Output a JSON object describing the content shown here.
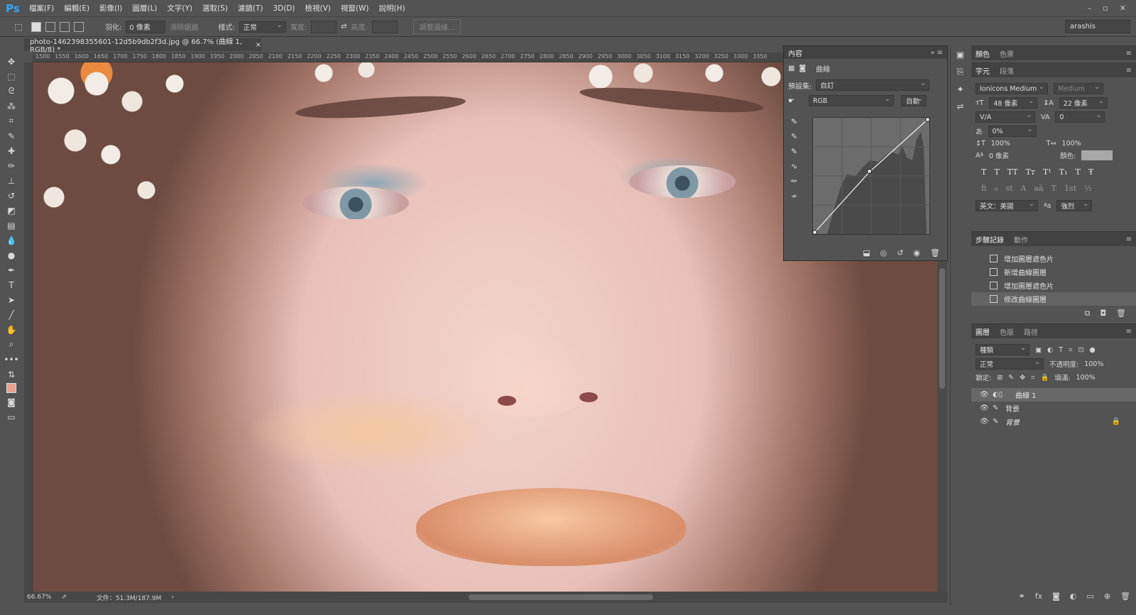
{
  "app": {
    "logo": "Ps"
  },
  "menu": [
    "檔案(F)",
    "編輯(E)",
    "影像(I)",
    "圖層(L)",
    "文字(Y)",
    "選取(S)",
    "濾鏡(T)",
    "3D(D)",
    "檢視(V)",
    "視窗(W)",
    "說明(H)"
  ],
  "window_controls": [
    "–",
    "▫",
    "✕"
  ],
  "options": {
    "feather_label": "羽化:",
    "feather_value": "0 像素",
    "antialias_label": "消除鋸齒",
    "style_label": "樣式:",
    "style_value": "正常",
    "width_label": "寬度:",
    "height_label": "高度:",
    "refine_button": "調整邊緣...",
    "workspace": "arashis"
  },
  "document": {
    "tab_title": "photo-1462398355601-12d5b9db2f3d.jpg @ 66.7% (曲線 1, RGB/8) *",
    "close": "×",
    "ruler_ticks": [
      "1500",
      "1550",
      "1600",
      "1650",
      "1700",
      "1750",
      "1800",
      "1850",
      "1900",
      "1950",
      "2000",
      "2050",
      "2100",
      "2150",
      "2200",
      "2250",
      "2300",
      "2350",
      "2400",
      "2450",
      "2500",
      "2550",
      "2600",
      "2650",
      "2700",
      "2750",
      "2800",
      "2850",
      "2900",
      "2950",
      "3000",
      "3050",
      "3100",
      "3150",
      "3200",
      "3250",
      "3300",
      "3350"
    ]
  },
  "status": {
    "zoom": "66.67%",
    "doc_size": "文件：51.3M/187.9M"
  },
  "properties": {
    "tab": "內容",
    "type_label": "曲線",
    "preset_label": "預設集:",
    "preset_value": "自訂",
    "channel": "RGB",
    "auto_button": "自動"
  },
  "character": {
    "tabs": [
      "字元",
      "段落"
    ],
    "font_family": "Ionicons Medium",
    "font_style": "Medium",
    "font_size": "48 像素",
    "leading": "22 像素",
    "kerning": "V/A",
    "tracking": "0",
    "scale_pct": "0%",
    "vscale": "100%",
    "hscale": "100%",
    "baseline": "0 像素",
    "color_label": "顏色:",
    "language": "英文：美國",
    "aa_label": "ªa",
    "antialias": "強烈",
    "style_glyphs": [
      "T",
      "T",
      "TT",
      "Tт",
      "T¹",
      "T₁",
      "T",
      "Ŧ"
    ],
    "ot_glyphs": [
      "fi",
      "ℴ",
      "st",
      "A",
      "aā",
      "T",
      "1st",
      "½"
    ]
  },
  "color_tabs": [
    "顏色",
    "色票"
  ],
  "history": {
    "tabs": [
      "步驟記錄",
      "動作"
    ],
    "items": [
      "增加圖層遮色片",
      "新增曲線圖層",
      "增加圖層遮色片",
      "修改曲線圖層"
    ]
  },
  "layers": {
    "tabs": [
      "圖層",
      "色版",
      "路徑"
    ],
    "filter_kind": "種類",
    "blend_mode": "正常",
    "opacity_label": "不透明度:",
    "opacity": "100%",
    "lock_label": "鎖定:",
    "fill_label": "填滿:",
    "fill": "100%",
    "items": [
      {
        "name": "曲線 1",
        "selected": true
      },
      {
        "name": "背景",
        "selected": false
      },
      {
        "name": "背景",
        "selected": false,
        "italic": true,
        "locked": true
      }
    ]
  }
}
